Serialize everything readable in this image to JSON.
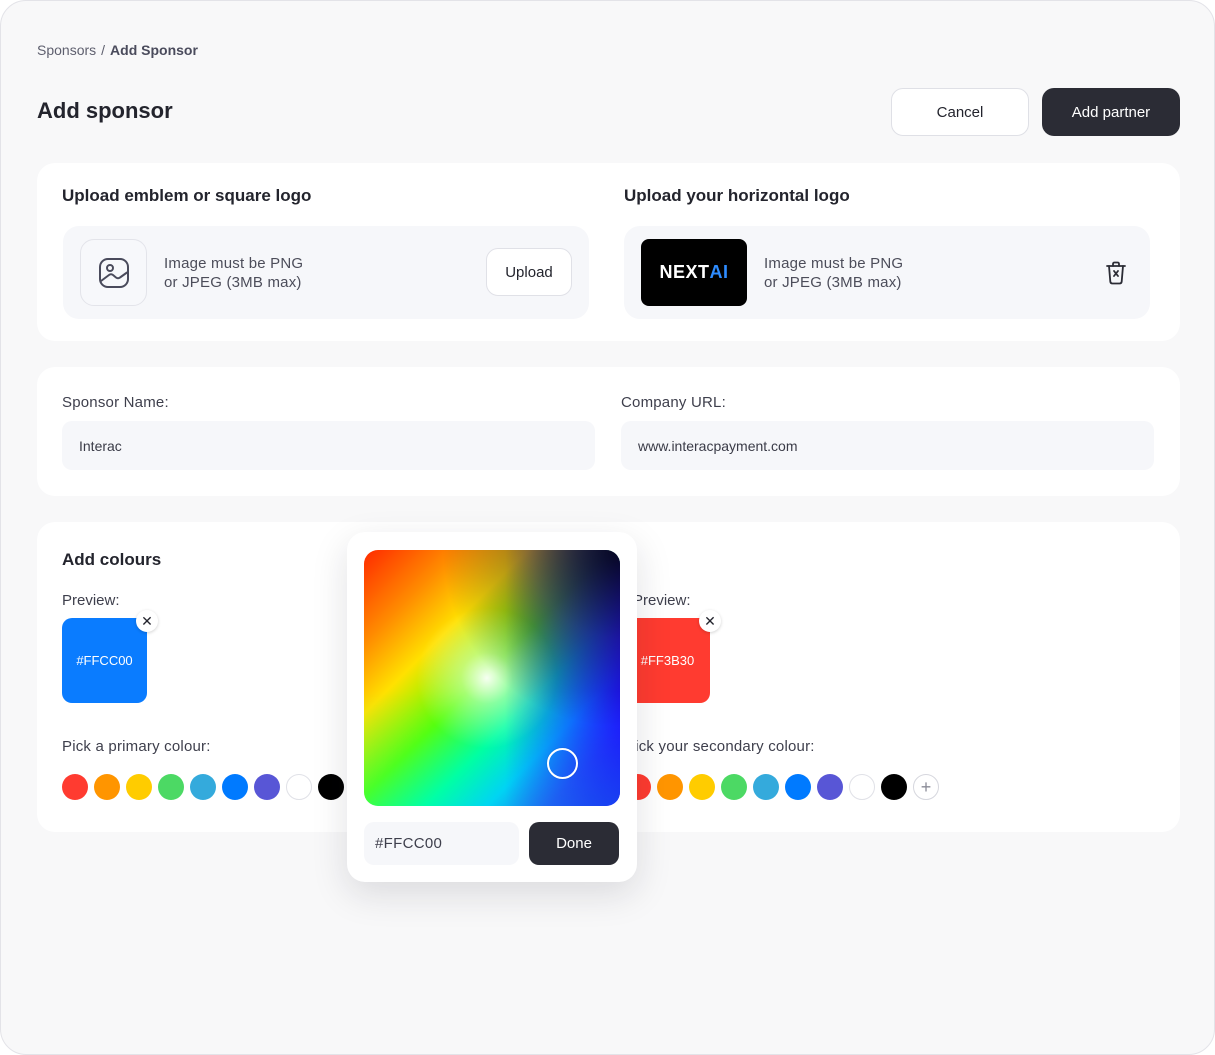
{
  "breadcrumb": {
    "parent": "Sponsors",
    "separator": "/",
    "current": "Add Sponsor"
  },
  "page_title": "Add sponsor",
  "actions": {
    "cancel": "Cancel",
    "submit": "Add partner"
  },
  "upload": {
    "square": {
      "title": "Upload emblem or square logo",
      "hint_line1": "Image must be PNG",
      "hint_line2": "or JPEG (3MB max)",
      "button": "Upload",
      "icon": "image-icon"
    },
    "horizontal": {
      "title": "Upload your horizontal logo",
      "logo_text_main": "NEXT",
      "logo_text_accent": "AI",
      "hint_line1": "Image must be PNG",
      "hint_line2": "or JPEG (3MB max)",
      "icon": "trash-icon"
    }
  },
  "fields": {
    "sponsor_name": {
      "label": "Sponsor Name:",
      "value": "Interac"
    },
    "company_url": {
      "label": "Company URL:",
      "value": "www.interacpayment.com"
    }
  },
  "colours": {
    "title": "Add colours",
    "primary": {
      "preview_label": "Preview:",
      "preview_text": "#FFCC00",
      "preview_color": "#0A7CFF",
      "pick_label": "Pick a primary colour:"
    },
    "secondary": {
      "preview_label": "Preview:",
      "preview_text": "#FF3B30",
      "preview_color": "#FF3B30",
      "pick_label": "Pick your secondary colour:"
    },
    "palette": [
      "#FF3B30",
      "#FF9500",
      "#FFCC00",
      "#4CD964",
      "#34AADC",
      "#007AFF",
      "#5856D6",
      "#FFFFFF",
      "#000000"
    ],
    "add_icon": "plus-icon",
    "remove_icon": "close-icon"
  },
  "picker": {
    "hex_value": "#FFCC00",
    "done": "Done"
  }
}
